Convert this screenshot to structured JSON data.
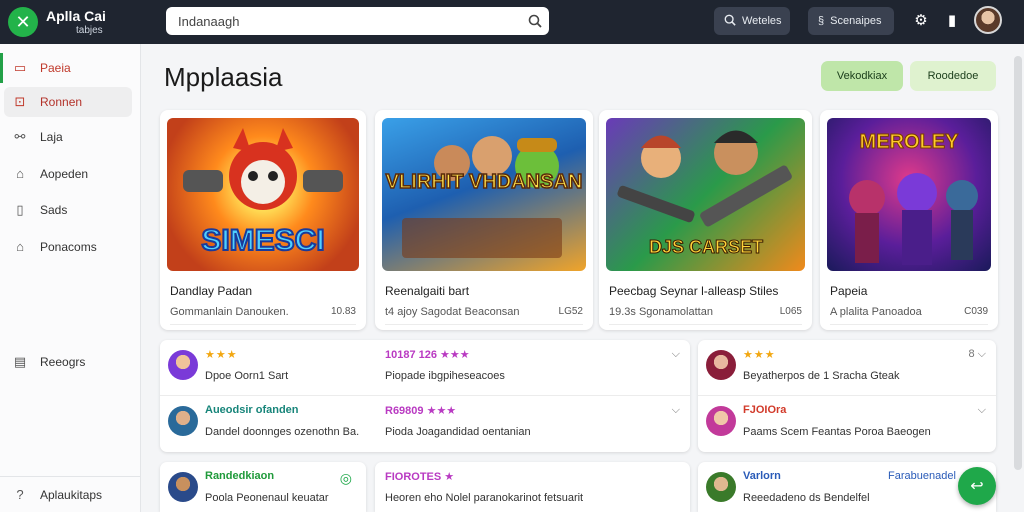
{
  "brand": {
    "title": "Aplla Cai",
    "subtitle": "tabjes"
  },
  "search": {
    "value": "Indanaagh"
  },
  "topbar": {
    "btn1_label": "Weteles",
    "btn2_label": "Scenaipes"
  },
  "sidebar": {
    "items": [
      {
        "label": "Paeia",
        "icon": "grid-icon"
      },
      {
        "label": "Ronnen",
        "icon": "box-icon"
      },
      {
        "label": "Laja",
        "icon": "link-icon"
      },
      {
        "label": "Aopeden",
        "icon": "bag-icon"
      },
      {
        "label": "Sads",
        "icon": "card-icon"
      },
      {
        "label": "Ponacoms",
        "icon": "user-icon"
      },
      {
        "label": "Reeogrs",
        "icon": "list-icon"
      }
    ],
    "footer_label": "Aplaukitaps"
  },
  "main": {
    "title": "Mpplaasia",
    "pill_a": "Vekodkiax",
    "pill_b": "Roodedoe"
  },
  "cards": [
    {
      "title": "Dandlay Padan",
      "sub": "Gommanlain Danouken.",
      "meta": "10.83",
      "art_text": "SIMESCI"
    },
    {
      "title": "Reenalgaiti bart",
      "sub": "t4 ajoy Sagodat Beaconsan",
      "meta": "LG52",
      "art_text": "VLIRHIT VHDANSAN"
    },
    {
      "title": "Peecbag Seynar l-alleasp Stiles",
      "sub": "19.3s Sgonamolattan",
      "meta": "L065",
      "art_text": "DJS CARSET"
    },
    {
      "title": "Papeia",
      "sub": "A plalita Panoadoa",
      "meta": "C039",
      "art_text": "MEROLEY"
    }
  ],
  "list_left": [
    {
      "t1": "★★★",
      "t1b": "",
      "t2": "Dpoe Oorn1 Sart",
      "t3_head": "10187 126 ★★★",
      "t3_body": "Piopade ibgpiheseacoes"
    },
    {
      "t1": "Aueodsir ofanden",
      "t1b": "",
      "t2": "Dandel doonnges ozenothn Ba.",
      "t3_head": "R69809 ★★★",
      "t3_body": "Pioda Joagandidad oentanian"
    },
    {
      "t1": "Randedkiaon",
      "t1b": "",
      "t2": "Poola Peonenaul keuatar",
      "t3_head": "FIOROTES ★",
      "t3_body": "Heoren eho Nolel paranokarinot fetsuarit"
    }
  ],
  "list_right": [
    {
      "t1": "★★★",
      "t2": "Beyatherpos de 1 Sracha Gteak",
      "chev": "8"
    },
    {
      "t1": "FJOIOra",
      "t2": "Paams Scem Feantas Poroa Baeogen",
      "chev": ""
    },
    {
      "t1": "Varlorn",
      "t2": "Reeedadeno ds Bendelfel",
      "tag": "Farabuenadel"
    }
  ],
  "colors": {
    "accent": "#1fa84a",
    "topbar": "#1f2530",
    "star": "#f2a711"
  }
}
